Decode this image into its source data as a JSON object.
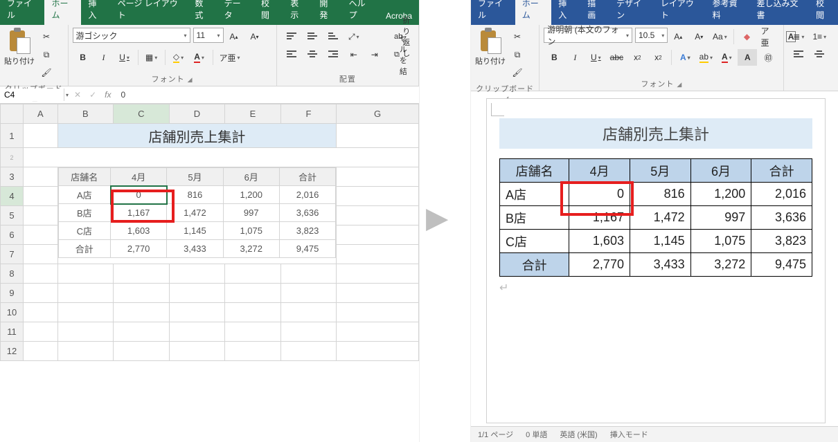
{
  "excel": {
    "tabs": [
      "ファイル",
      "ホーム",
      "挿入",
      "ページ レイアウト",
      "数式",
      "データ",
      "校閲",
      "表示",
      "開発",
      "ヘルプ",
      "Acroba"
    ],
    "active_tab": "ホーム",
    "groups": {
      "clipboard": "クリップボード",
      "font": "フォント",
      "align": "配置"
    },
    "clipboard": {
      "paste": "貼り付け"
    },
    "font": {
      "name": "游ゴシック",
      "size": "11"
    },
    "align_extra": {
      "wrap": "折り返し",
      "merge": "セルを結"
    },
    "namebox": {
      "cell": "C4",
      "formula": "0"
    },
    "columns": [
      "A",
      "B",
      "C",
      "D",
      "E",
      "F",
      "G"
    ],
    "rows": [
      "1",
      "2",
      "3",
      "4",
      "5",
      "6",
      "7",
      "8",
      "9",
      "10",
      "11",
      "12"
    ],
    "title": "店舗別売上集計",
    "table": {
      "headers": [
        "店舗名",
        "4月",
        "5月",
        "6月",
        "合計"
      ],
      "rows": [
        {
          "name": "A店",
          "vals": [
            "0",
            "816",
            "1,200",
            "2,016"
          ]
        },
        {
          "name": "B店",
          "vals": [
            "1,167",
            "1,472",
            "997",
            "3,636"
          ]
        },
        {
          "name": "C店",
          "vals": [
            "1,603",
            "1,145",
            "1,075",
            "3,823"
          ]
        }
      ],
      "total": {
        "name": "合計",
        "vals": [
          "2,770",
          "3,433",
          "3,272",
          "9,475"
        ]
      }
    }
  },
  "word": {
    "tabs": [
      "ファイル",
      "ホーム",
      "挿入",
      "描画",
      "デザイン",
      "レイアウト",
      "参考資料",
      "差し込み文書",
      "校閲"
    ],
    "active_tab": "ホーム",
    "groups": {
      "clipboard": "クリップボード",
      "font": "フォント"
    },
    "clipboard": {
      "paste": "貼り付け"
    },
    "font": {
      "name": "游明朝 (本文のフォン",
      "size": "10.5"
    },
    "title": "店舗別売上集計",
    "table": {
      "headers": [
        "店舗名",
        "4月",
        "5月",
        "6月",
        "合計"
      ],
      "rows": [
        {
          "name": "A店",
          "vals": [
            "0",
            "816",
            "1,200",
            "2,016"
          ]
        },
        {
          "name": "B店",
          "vals": [
            "1,167",
            "1,472",
            "997",
            "3,636"
          ]
        },
        {
          "name": "C店",
          "vals": [
            "1,603",
            "1,145",
            "1,075",
            "3,823"
          ]
        }
      ],
      "total": {
        "name": "合計",
        "vals": [
          "2,770",
          "3,433",
          "3,272",
          "9,475"
        ]
      }
    },
    "status": {
      "page": "1/1 ページ",
      "words": "0 単語",
      "lang": "英語 (米国)",
      "mode": "挿入モード"
    }
  },
  "chart_data": {
    "type": "table",
    "title": "店舗別売上集計",
    "columns": [
      "店舗名",
      "4月",
      "5月",
      "6月",
      "合計"
    ],
    "rows": [
      [
        "A店",
        0,
        816,
        1200,
        2016
      ],
      [
        "B店",
        1167,
        1472,
        997,
        3636
      ],
      [
        "C店",
        1603,
        1145,
        1075,
        3823
      ],
      [
        "合計",
        2770,
        3433,
        3272,
        9475
      ]
    ]
  }
}
